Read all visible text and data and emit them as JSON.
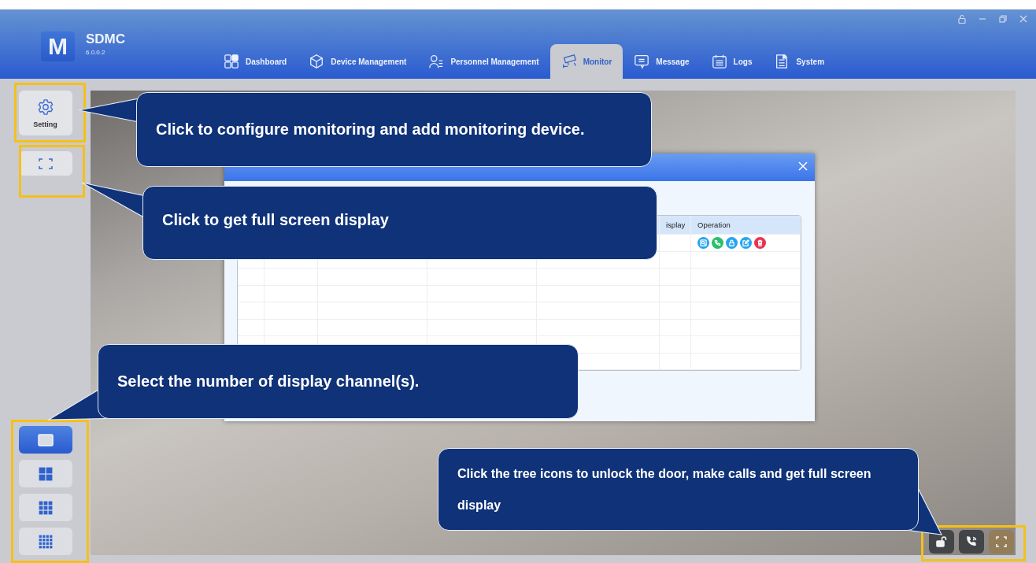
{
  "app": {
    "logo": "M",
    "name": "SDMC",
    "version": "6.0.0.2"
  },
  "nav_tabs": [
    {
      "kind": "dashboard",
      "label": "Dashboard",
      "selected": false
    },
    {
      "kind": "device",
      "label": "Device Management",
      "selected": false
    },
    {
      "kind": "personnel",
      "label": "Personnel Management",
      "selected": false
    },
    {
      "kind": "monitor",
      "label": "Monitor",
      "selected": true
    },
    {
      "kind": "message",
      "label": "Message",
      "selected": false
    },
    {
      "kind": "logs",
      "label": "Logs",
      "selected": false
    },
    {
      "kind": "system",
      "label": "System",
      "selected": false
    }
  ],
  "sidebar": {
    "setting_button": {
      "label": "Setting"
    },
    "layouts": [
      {
        "kind": "single",
        "selected": true
      },
      {
        "kind": "quad",
        "selected": false
      },
      {
        "kind": "nine",
        "selected": false
      },
      {
        "kind": "sixteen",
        "selected": false
      }
    ]
  },
  "monitor_dialog": {
    "table": {
      "columns": [
        {
          "label": "isplay"
        },
        {
          "label": "Operation"
        }
      ]
    }
  },
  "callouts": [
    {
      "text": "Click to configure monitoring and add monitoring device."
    },
    {
      "text": "Click to get full screen display"
    },
    {
      "text": "Select the number of display channel(s)."
    },
    {
      "text": "Click the tree icons to unlock the door, make calls and get full screen display"
    }
  ]
}
